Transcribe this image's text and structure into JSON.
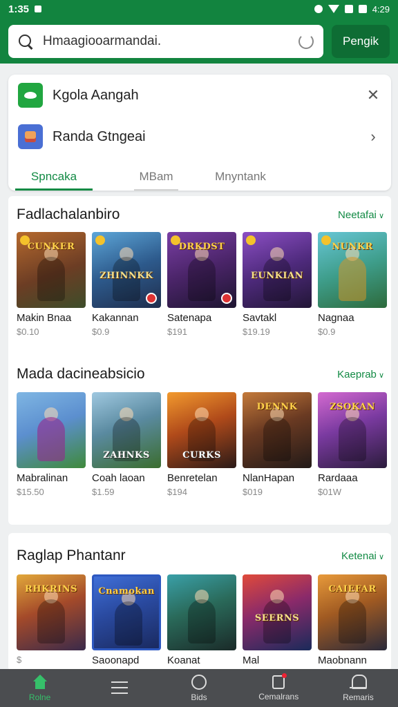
{
  "status_bar": {
    "time": "1:35",
    "right_text": "4:29"
  },
  "search": {
    "value": "Hmaagiooarmandai.",
    "button_label": "Pengik"
  },
  "filters": {
    "row1_label": "Kgola Aangah",
    "row2_label": "Randa Gtngeai",
    "tabs": [
      "Spncaka",
      "MBam",
      "Mnyntank"
    ]
  },
  "sections": [
    {
      "title": "Fadlachalanbiro",
      "more": "Neetafai",
      "items": [
        {
          "name": "Makin Bnaa",
          "price": "$0.10",
          "art": "CUNKER"
        },
        {
          "name": "Kakannan",
          "price": "$0.9",
          "art": "ZHINNKK"
        },
        {
          "name": "Satenapa",
          "price": "$191",
          "art": "DRKDST"
        },
        {
          "name": "Savtakl",
          "price": "$19.19",
          "art": "EUNKIAN"
        },
        {
          "name": "Nagnaa",
          "price": "$0.9",
          "art": "NUNKR"
        }
      ]
    },
    {
      "title": "Mada dacineabsicio",
      "more": "Kaeprab",
      "items": [
        {
          "name": "Mabralinan",
          "price": "$15.50",
          "art": ""
        },
        {
          "name": "Coah laoan",
          "price": "$1.59",
          "art": "ZAHNKS"
        },
        {
          "name": "Benretelan",
          "price": "$194",
          "art": "CURKS"
        },
        {
          "name": "NlanHapan",
          "price": "$019",
          "art": "DENNK"
        },
        {
          "name": "Rardaaa",
          "price": "$01W",
          "art": "ZSOKAN"
        }
      ]
    },
    {
      "title": "Raglap Phantanr",
      "more": "Ketenai",
      "items": [
        {
          "name": "",
          "price": "$",
          "art": "RHKRINS"
        },
        {
          "name": "Saoonapd",
          "price": "$",
          "art": "Cnamokan"
        },
        {
          "name": "Koanat",
          "price": "$",
          "art": ""
        },
        {
          "name": "Mal",
          "price": "",
          "art": "SEERNS"
        },
        {
          "name": "Maobnann",
          "price": "$",
          "art": "CAIEFAR"
        }
      ]
    }
  ],
  "bottom_nav": [
    "Rolne",
    "",
    "Bids",
    "Cemalrans",
    "Remaris"
  ],
  "colors": {
    "brand": "#12843f",
    "accent": "#128a44",
    "nav_bg": "#4b4d50"
  }
}
